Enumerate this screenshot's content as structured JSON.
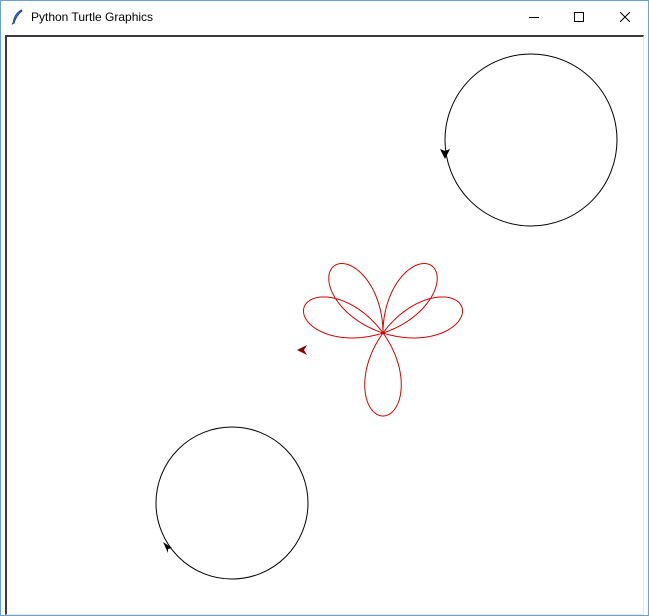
{
  "window": {
    "title": "Python Turtle Graphics",
    "icon": "feather-icon",
    "controls": [
      "minimize-icon",
      "maximize-icon",
      "close-icon"
    ]
  },
  "canvas": {
    "background": "#ffffff",
    "shapes": [
      {
        "name": "circle-top-right",
        "type": "circle",
        "color": "#000000",
        "turtle": "arrow"
      },
      {
        "name": "rose-curve",
        "type": "rose",
        "petals": 5,
        "color": "#d40000",
        "turtle": "arrow"
      },
      {
        "name": "circle-bottom-left",
        "type": "circle",
        "color": "#000000",
        "turtle": "arrow"
      }
    ]
  }
}
